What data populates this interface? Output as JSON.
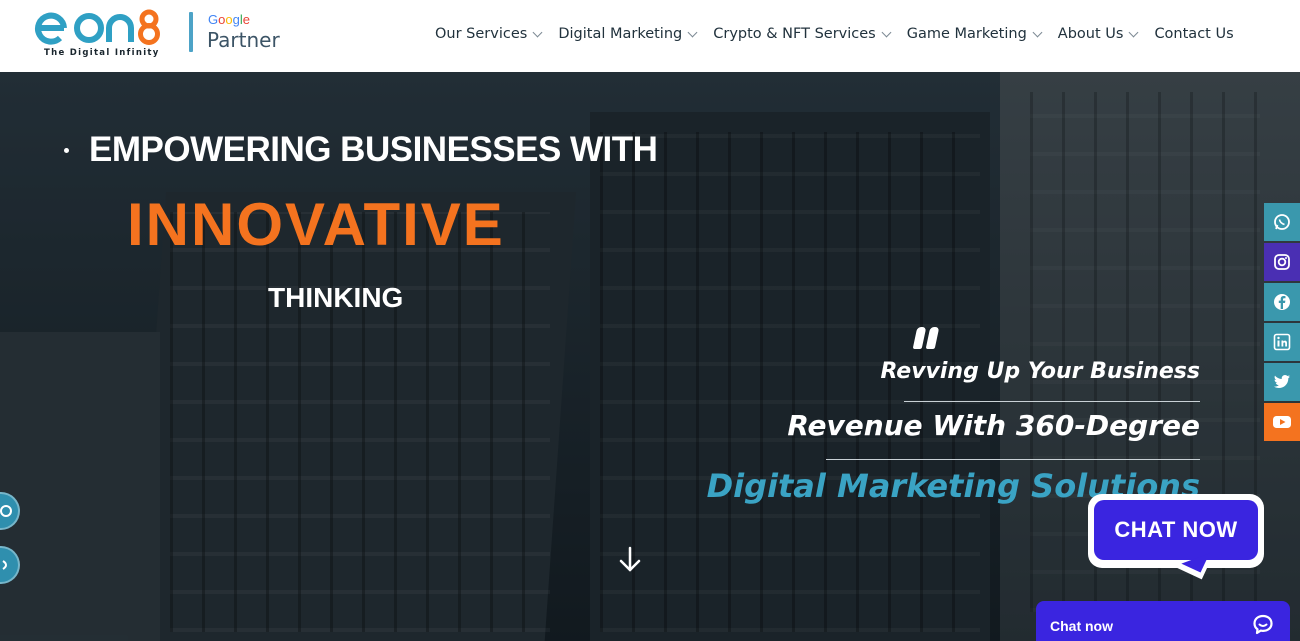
{
  "header": {
    "logo_text": "eon8",
    "logo_tagline": "The Digital Infinity",
    "partner_google": "Google",
    "partner_label": "Partner",
    "nav": [
      {
        "label": "Our Services",
        "has_dropdown": true
      },
      {
        "label": "Digital Marketing",
        "has_dropdown": true
      },
      {
        "label": "Crypto & NFT Services",
        "has_dropdown": true
      },
      {
        "label": "Game Marketing",
        "has_dropdown": true
      },
      {
        "label": "About Us",
        "has_dropdown": true
      },
      {
        "label": "Contact Us",
        "has_dropdown": false
      }
    ]
  },
  "hero": {
    "line1": "EMPOWERING BUSINESSES WITH",
    "line2": "INNOVATIVE",
    "line3": "THINKING",
    "tagline_a": "Revving Up Your Business",
    "tagline_b": "Revenue With 360-Degree",
    "tagline_c": "Digital Marketing Solutions"
  },
  "social": [
    {
      "icon": "whatsapp-icon",
      "color": "#3a98ad"
    },
    {
      "icon": "instagram-icon",
      "color": "#4a2fb3"
    },
    {
      "icon": "facebook-icon",
      "color": "#3a98ad"
    },
    {
      "icon": "linkedin-icon",
      "color": "#3a98ad"
    },
    {
      "icon": "twitter-icon",
      "color": "#3a98ad"
    },
    {
      "icon": "youtube-icon",
      "color": "#f4731f"
    }
  ],
  "chat": {
    "bubble_label": "CHAT NOW",
    "bar_label": "Chat now"
  },
  "colors": {
    "brand_orange": "#f4731f",
    "brand_teal": "#3aa3c4",
    "chat_purple": "#3a25e0"
  }
}
